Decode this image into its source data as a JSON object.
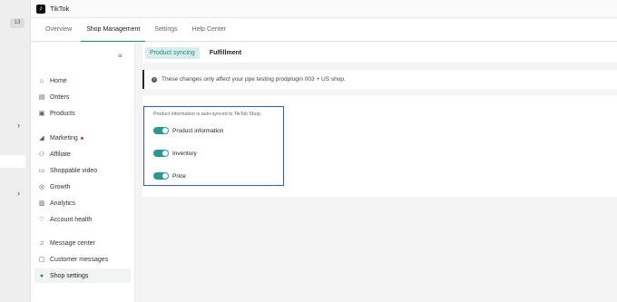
{
  "outer_strip": {
    "badge": "13",
    "chevron_1": "›",
    "chevron_2": "›"
  },
  "header": {
    "logo_glyph": "♪",
    "title": "TikTok"
  },
  "main_tabs": [
    {
      "label": "Overview"
    },
    {
      "label": "Shop Management"
    },
    {
      "label": "Settings"
    },
    {
      "label": "Help Center"
    }
  ],
  "sidebar": {
    "collapse_glyph": "≡",
    "items": [
      {
        "label": "Home",
        "icon": "⌂"
      },
      {
        "label": "Orders",
        "icon": "▤"
      },
      {
        "label": "Products",
        "icon": "▣"
      },
      {
        "label": "Marketing",
        "icon": "◢"
      },
      {
        "label": "Affiliate",
        "icon": "⚇"
      },
      {
        "label": "Shoppable video",
        "icon": "▭"
      },
      {
        "label": "Growth",
        "icon": "◎"
      },
      {
        "label": "Analytics",
        "icon": "▥"
      },
      {
        "label": "Account health",
        "icon": "♡"
      },
      {
        "label": "Message center",
        "icon": "♫"
      },
      {
        "label": "Customer messages",
        "icon": "▢"
      },
      {
        "label": "Shop settings",
        "icon": "●"
      }
    ]
  },
  "sub_tabs": [
    {
      "label": "Product syncing"
    },
    {
      "label": "Fulfillment"
    }
  ],
  "notice": {
    "icon_glyph": "!",
    "text": "These changes only affect your ppe testing prodplugin 003 + US shop."
  },
  "sync": {
    "caption": "Product information is auto-synced to TikTok Shop.",
    "toggles": [
      {
        "label": "Product information"
      },
      {
        "label": "Inventory"
      },
      {
        "label": "Price"
      }
    ]
  },
  "colors": {
    "accent": "#1d8a80",
    "toggle_on": "#2a9a90",
    "highlight_border": "#3356c9",
    "notification_dot": "#e0303b"
  }
}
